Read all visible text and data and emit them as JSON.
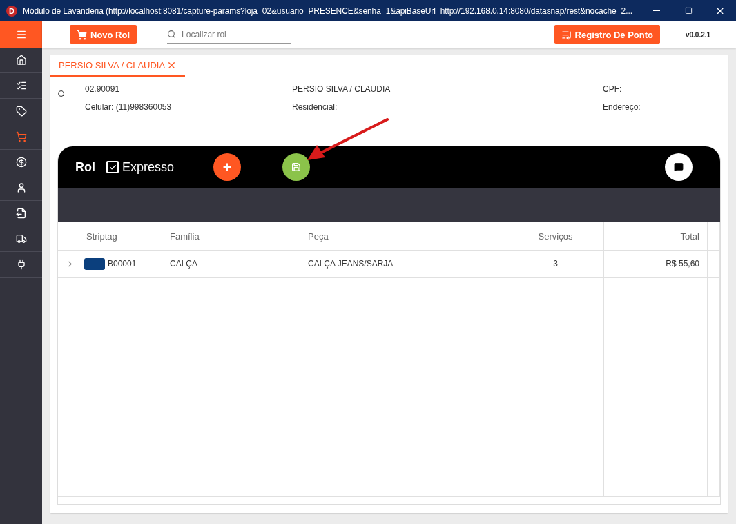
{
  "window": {
    "icon_letter": "D",
    "title": "Módulo de Lavanderia (http://localhost:8081/capture-params?loja=02&usuario=PRESENCE&senha=1&apiBaseUrl=http://192.168.0.14:8080/datasnap/rest&nocache=2..."
  },
  "toolbar": {
    "new_button": "Novo Rol",
    "search": {
      "placeholder": "Localizar rol"
    },
    "clock_button": "Registro De Ponto",
    "version": "v0.0.2.1"
  },
  "sidebar": {
    "items": [
      {
        "selected": false
      },
      {
        "selected": false
      },
      {
        "selected": false
      },
      {
        "selected": true
      },
      {
        "selected": false
      },
      {
        "selected": false
      },
      {
        "selected": false
      },
      {
        "selected": false
      },
      {
        "selected": false
      }
    ]
  },
  "tabs": [
    {
      "label": "PERSIO SILVA / CLAUDIA",
      "selected": true
    }
  ],
  "customer": {
    "code": "02.90091",
    "name": "PERSIO SILVA / CLAUDIA",
    "cpf": "CPF:",
    "mobile": "Celular: (11)998360053",
    "home_phone": "Residencial:",
    "address": "Endereço:"
  },
  "rol": {
    "title": "Rol",
    "express": {
      "label": "Expresso",
      "checked": true
    },
    "table": {
      "columns": [
        "Striptag",
        "Família",
        "Peça",
        "Serviços",
        "Total"
      ],
      "rows": [
        {
          "color": "#0b3f7d",
          "striptag": "B00001",
          "family": "CALÇA",
          "piece": "CALÇA JEANS/SARJA",
          "services": "3",
          "total": "R$ 55,60",
          "expanded": false
        }
      ]
    }
  }
}
